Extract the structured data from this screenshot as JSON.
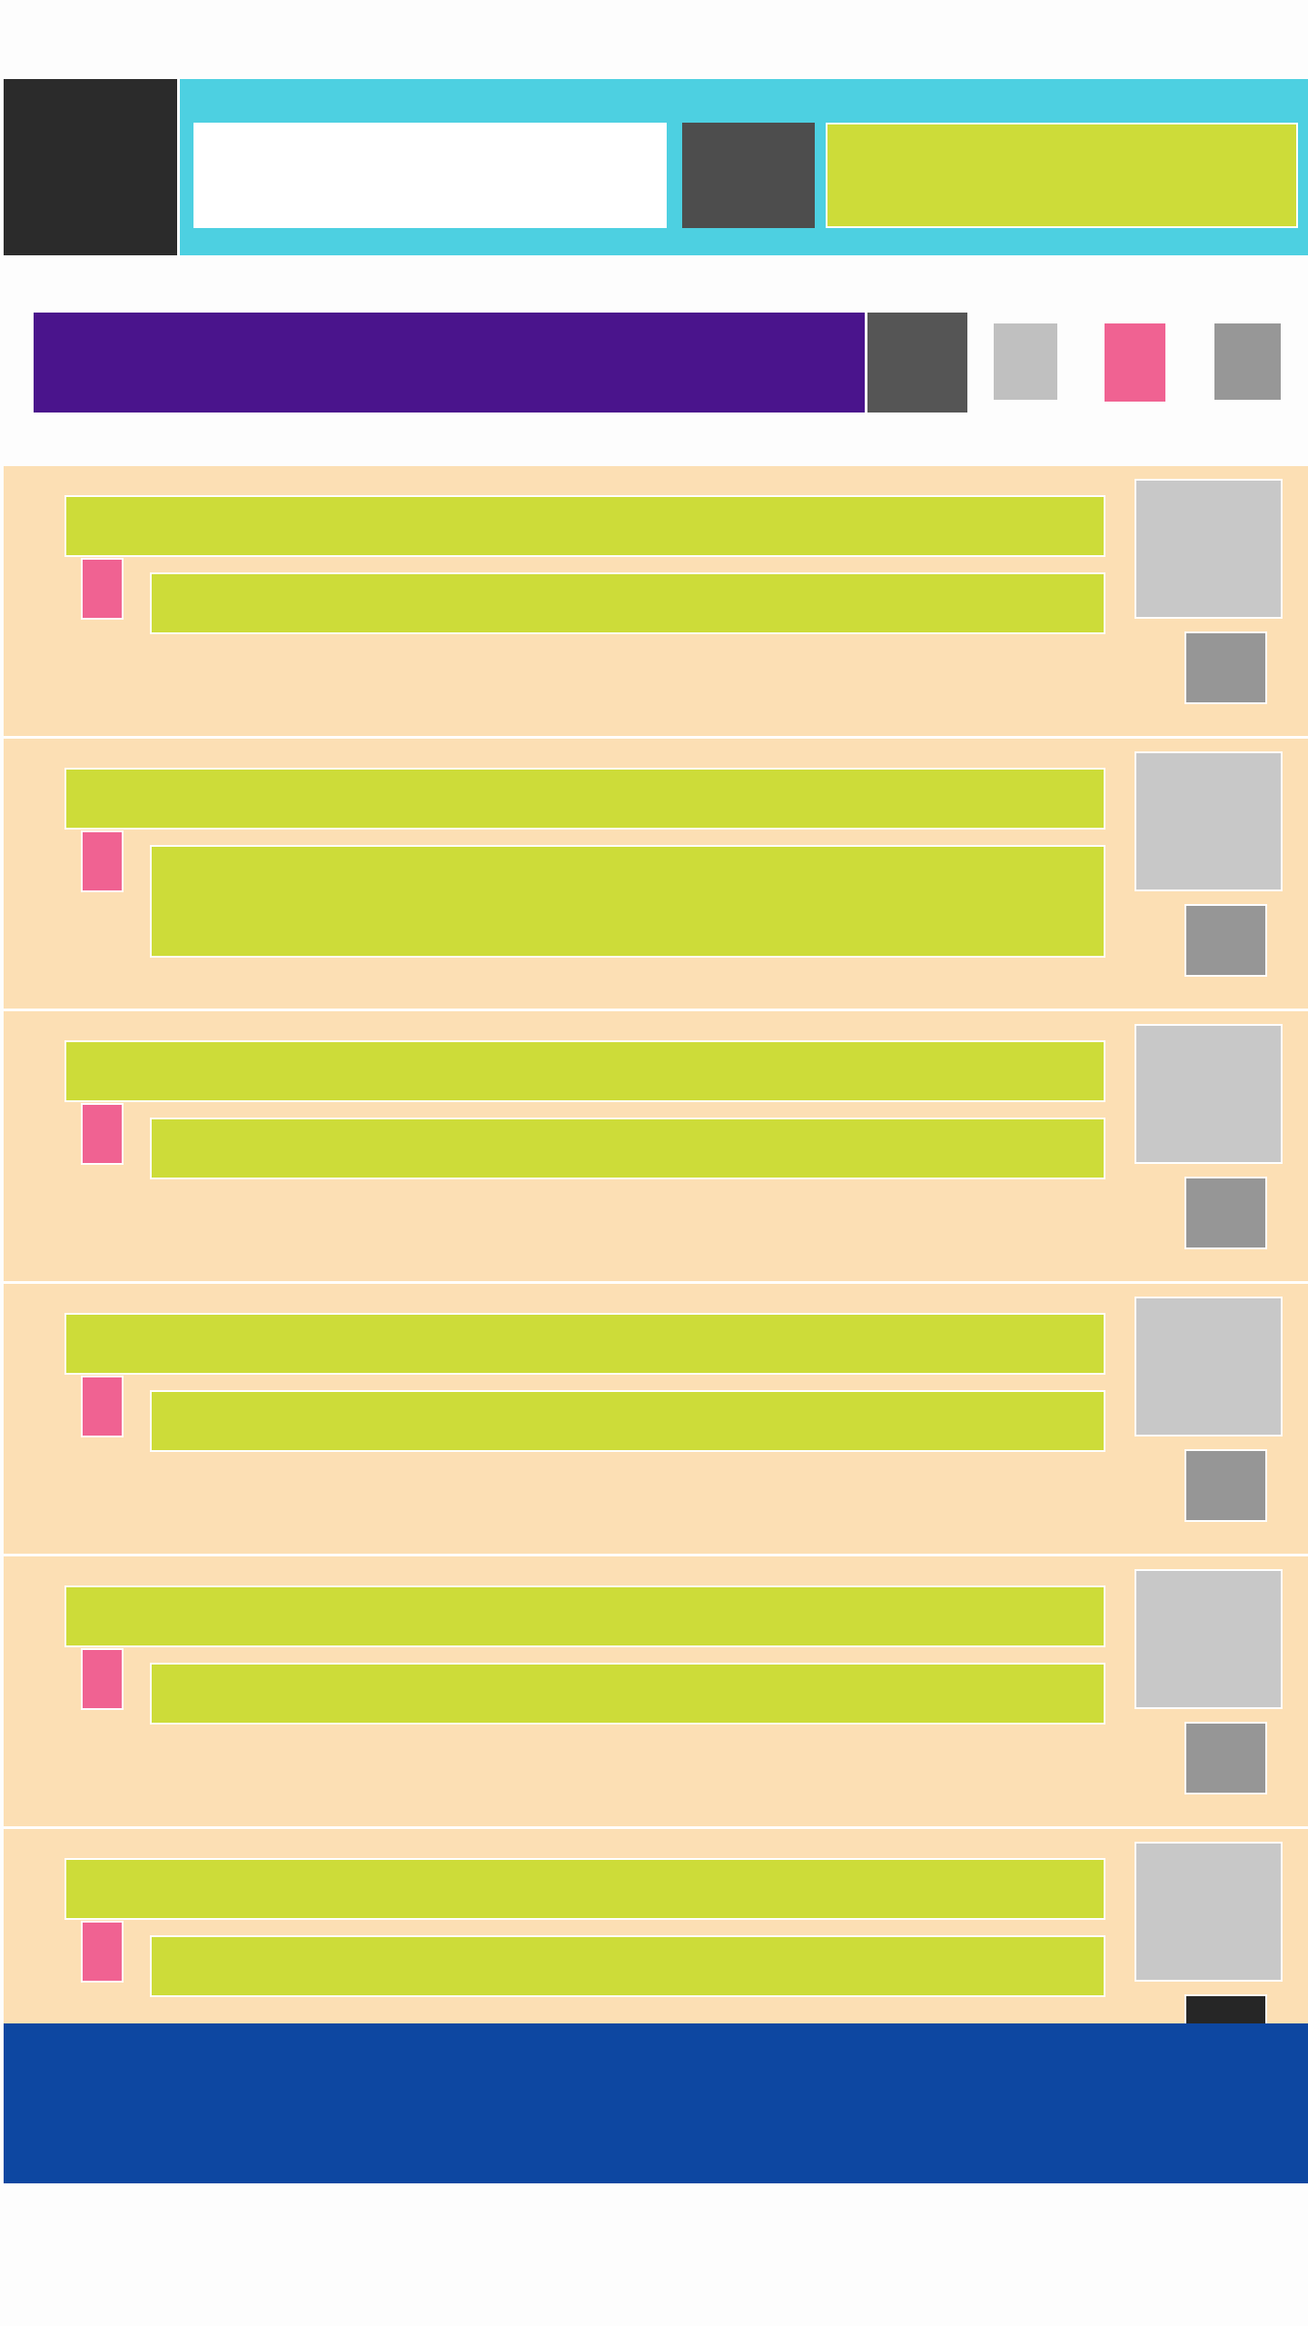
{
  "colors": {
    "page_background": "#fdfdfd",
    "header_background": "#4dd0e1",
    "logo_block": "#2b2b2b",
    "search_button": "#4d4d4d",
    "accent_lime": "#cddc39",
    "title_bar": "#4a148c",
    "menu_button": "#555555",
    "tag_pink": "#f06292",
    "thumbnail_gray": "#c8c8c8",
    "action_gray": "#969696",
    "list_background": "#fcdfb4",
    "footer_background": "#0d47a1"
  },
  "header": {
    "logo": "",
    "search": {
      "value": "",
      "placeholder": ""
    },
    "search_button_label": "",
    "cta_label": ""
  },
  "toolbar": {
    "title": "",
    "menu_label": "",
    "icons": [
      {
        "name": "light-gray-tool-icon",
        "label": ""
      },
      {
        "name": "pink-tool-icon",
        "label": ""
      },
      {
        "name": "gray-tool-icon",
        "label": ""
      }
    ]
  },
  "list": {
    "items": [
      {
        "title": "",
        "tag": "",
        "body": "",
        "action": "",
        "tall_body": false,
        "dark_action": false
      },
      {
        "title": "",
        "tag": "",
        "body": "",
        "action": "",
        "tall_body": true,
        "dark_action": false
      },
      {
        "title": "",
        "tag": "",
        "body": "",
        "action": "",
        "tall_body": false,
        "dark_action": false
      },
      {
        "title": "",
        "tag": "",
        "body": "",
        "action": "",
        "tall_body": false,
        "dark_action": false
      },
      {
        "title": "",
        "tag": "",
        "body": "",
        "action": "",
        "tall_body": false,
        "dark_action": false
      },
      {
        "title": "",
        "tag": "",
        "body": "",
        "action": "",
        "tall_body": false,
        "dark_action": true
      }
    ]
  },
  "footer": {
    "text": ""
  }
}
